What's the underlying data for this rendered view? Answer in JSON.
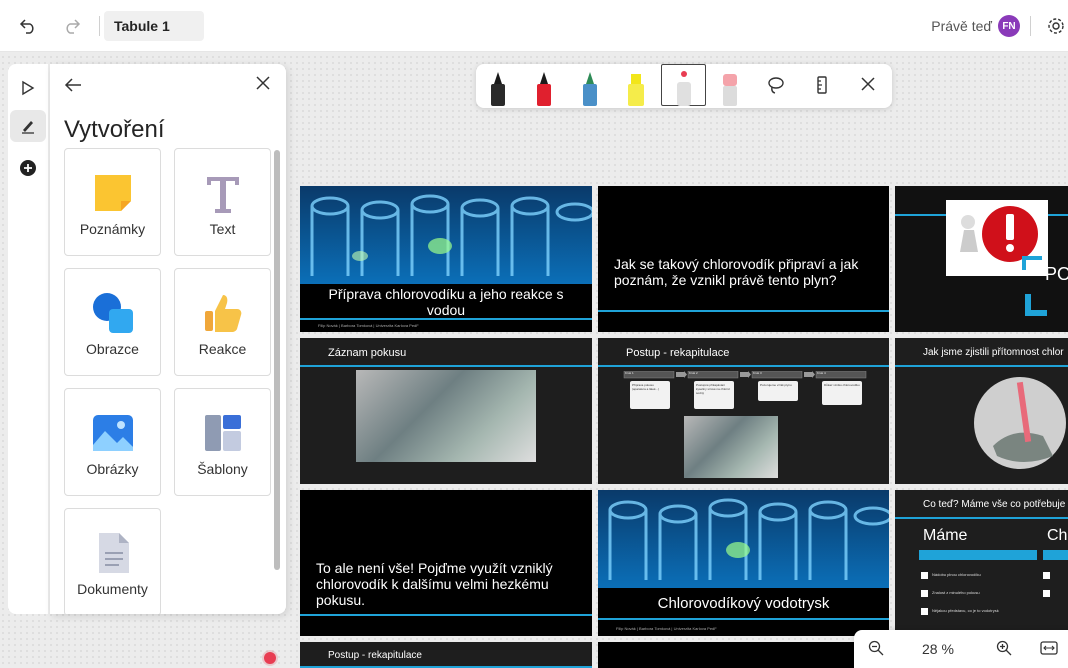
{
  "header": {
    "board_title": "Tabule 1",
    "status": "Právě teď",
    "avatar_initials": "FN"
  },
  "panel": {
    "title": "Vytvoření",
    "tiles": [
      {
        "label": "Poznámky",
        "icon": "sticky-note-icon"
      },
      {
        "label": "Text",
        "icon": "text-icon"
      },
      {
        "label": "Obrazce",
        "icon": "shapes-icon"
      },
      {
        "label": "Reakce",
        "icon": "thumbs-up-icon"
      },
      {
        "label": "Obrázky",
        "icon": "image-icon"
      },
      {
        "label": "Šablony",
        "icon": "template-icon"
      },
      {
        "label": "Dokumenty",
        "icon": "document-icon"
      }
    ]
  },
  "pen_toolbar": {
    "pens": [
      {
        "name": "black",
        "color": "#1a1a1a"
      },
      {
        "name": "red",
        "color": "#e0202e"
      },
      {
        "name": "green",
        "color": "#2e8b57"
      },
      {
        "name": "highlighter",
        "color": "#f2e61a"
      },
      {
        "name": "laser",
        "color": "#e6e6e6"
      },
      {
        "name": "eraser",
        "color": "#f4a3aa"
      }
    ]
  },
  "slides": {
    "s1": {
      "title": "Příprava chlorovodíku a jeho reakce s vodou",
      "credit": "Filip Novák | Barbora Tomková | Univerzita Karlova PedF"
    },
    "s2": {
      "title": "Jak se takový chlorovodík připraví a jak poznám, že vznikl právě tento plyn?"
    },
    "s3": {
      "title": "PO"
    },
    "s4": {
      "title": "Záznam pokusu"
    },
    "s5": {
      "title": "Postup - rekapitulace",
      "steps": [
        "Krok 1",
        "Krok 2",
        "Krok 3",
        "Krok 4"
      ],
      "cards": [
        "Příprava pokusu (aparatura a látek...)",
        "Postupné přikapávání kyseliny sírové na chlorid sodný",
        "Pozorujeme vznik plynu",
        "Důkaz vzniku chlorovodíku"
      ]
    },
    "s6": {
      "title": "Jak jsme zjistili přítomnost chlor"
    },
    "s7": {
      "title": "To ale není vše! Pojďme využít vzniklý chlorovodík k dalšímu velmi hezkému pokusu."
    },
    "s8": {
      "title": "Chlorovodíkový vodotrysk",
      "credit": "Filip Novák | Barbora Tomková | Univerzita Karlova PedF"
    },
    "s9": {
      "title": "Co teď? Máme vše co potřebuje",
      "col1": "Máme",
      "col2": "Ch",
      "items": [
        "Nádobu plnou chlorovodíku",
        "Znalost z minulého pokusu",
        "Nějakou představu, co je to vodotrysk"
      ]
    },
    "s10": {
      "title": "Postup - rekapitulace"
    }
  },
  "zoom": {
    "value": "28 %"
  }
}
